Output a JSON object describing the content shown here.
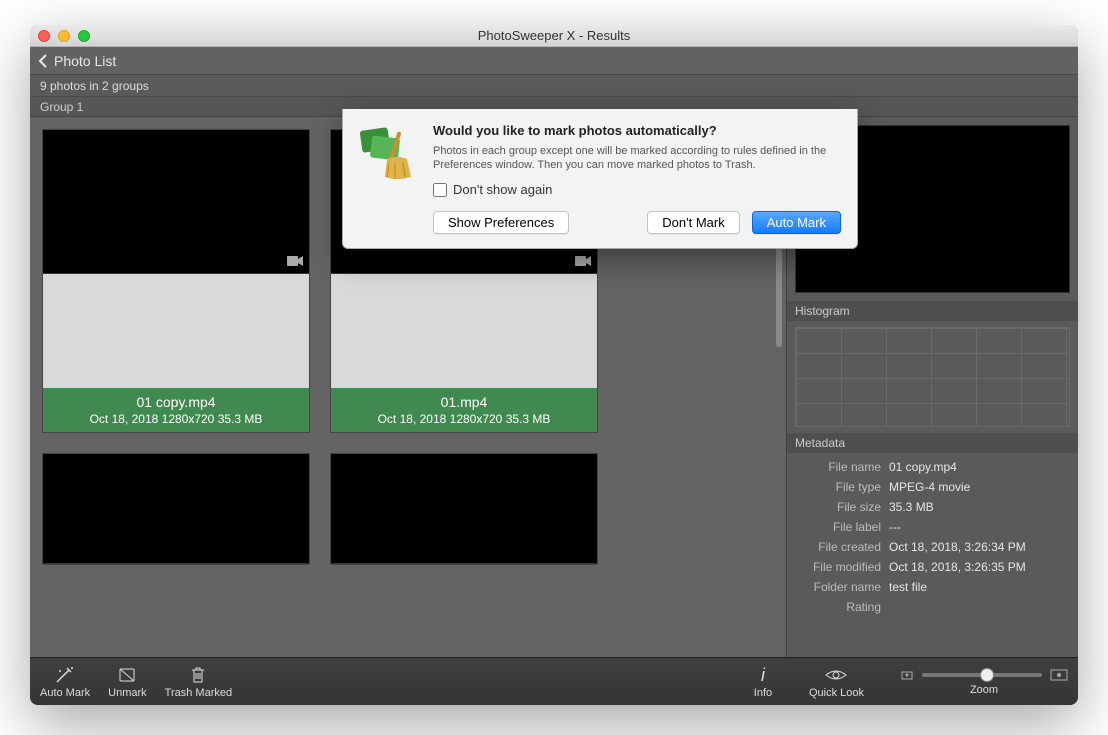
{
  "window": {
    "title": "PhotoSweeper X - Results"
  },
  "header": {
    "back_label": "Photo List"
  },
  "status": {
    "summary": "9 photos in 2 groups"
  },
  "group": {
    "label": "Group 1"
  },
  "cards": [
    {
      "name": "01 copy.mp4",
      "meta": "Oct 18, 2018   1280x720   35.3 MB"
    },
    {
      "name": "01.mp4",
      "meta": "Oct 18, 2018   1280x720   35.3 MB"
    }
  ],
  "side": {
    "histogram_label": "Histogram",
    "metadata_label": "Metadata",
    "meta": {
      "file_name_k": "File name",
      "file_name_v": "01 copy.mp4",
      "file_type_k": "File type",
      "file_type_v": "MPEG-4 movie",
      "file_size_k": "File size",
      "file_size_v": "35.3 MB",
      "file_label_k": "File label",
      "file_label_v": "---",
      "file_created_k": "File created",
      "file_created_v": "Oct 18, 2018, 3:26:34 PM",
      "file_modified_k": "File modified",
      "file_modified_v": "Oct 18, 2018, 3:26:35 PM",
      "folder_name_k": "Folder name",
      "folder_name_v": "test file",
      "rating_k": "Rating"
    }
  },
  "toolbar": {
    "auto_mark": "Auto Mark",
    "unmark": "Unmark",
    "trash_marked": "Trash Marked",
    "info": "Info",
    "quick_look": "Quick Look",
    "zoom": "Zoom"
  },
  "dialog": {
    "title": "Would you like to mark photos automatically?",
    "body": "Photos in each group except one will be marked according to rules defined in the Preferences window. Then you can move marked photos to Trash.",
    "dont_show": "Don't show again",
    "show_prefs": "Show Preferences",
    "dont_mark": "Don't Mark",
    "auto_mark": "Auto Mark"
  }
}
